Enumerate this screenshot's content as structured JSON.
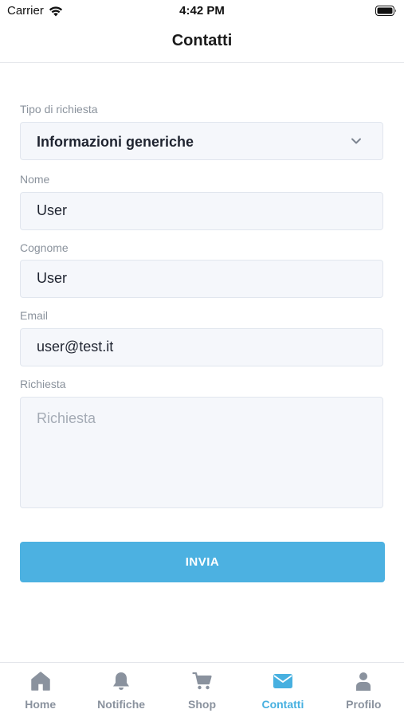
{
  "status_bar": {
    "carrier": "Carrier",
    "time": "4:42 PM"
  },
  "nav": {
    "title": "Contatti"
  },
  "form": {
    "request_type": {
      "label": "Tipo di richiesta",
      "value": "Informazioni generiche"
    },
    "first_name": {
      "label": "Nome",
      "value": "User"
    },
    "last_name": {
      "label": "Cognome",
      "value": "User"
    },
    "email": {
      "label": "Email",
      "value": "user@test.it"
    },
    "request": {
      "label": "Richiesta",
      "placeholder": "Richiesta"
    },
    "submit_label": "INVIA"
  },
  "tabs": [
    {
      "label": "Home",
      "icon": "home-icon"
    },
    {
      "label": "Notifiche",
      "icon": "bell-icon"
    },
    {
      "label": "Shop",
      "icon": "cart-icon"
    },
    {
      "label": "Contatti",
      "icon": "mail-icon",
      "active": true
    },
    {
      "label": "Profilo",
      "icon": "user-icon"
    }
  ],
  "colors": {
    "accent": "#4cb1e1",
    "inactive_tab": "#8a929e",
    "field_bg": "#f5f7fb"
  }
}
